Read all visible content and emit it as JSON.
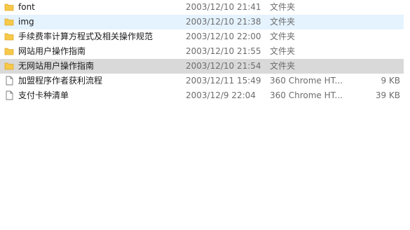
{
  "file_list": {
    "rows": [
      {
        "name": "font",
        "date": "2003/12/10 21:41",
        "type": "文件夹",
        "size": "",
        "icon": "folder-icon",
        "state": "normal"
      },
      {
        "name": "img",
        "date": "2003/12/10 21:38",
        "type": "文件夹",
        "size": "",
        "icon": "folder-icon",
        "state": "hover"
      },
      {
        "name": "手续费率计算方程式及相关操作规范",
        "date": "2003/12/10 22:00",
        "type": "文件夹",
        "size": "",
        "icon": "folder-icon",
        "state": "normal"
      },
      {
        "name": "网站用户操作指南",
        "date": "2003/12/10 21:55",
        "type": "文件夹",
        "size": "",
        "icon": "folder-icon",
        "state": "normal"
      },
      {
        "name": "无网站用户操作指南",
        "date": "2003/12/10 21:54",
        "type": "文件夹",
        "size": "",
        "icon": "folder-icon",
        "state": "selected"
      },
      {
        "name": "加盟程序作者获利流程",
        "date": "2003/12/11 15:49",
        "type": "360 Chrome HT...",
        "size": "9 KB",
        "icon": "file-icon",
        "state": "normal"
      },
      {
        "name": "支付卡种清单",
        "date": "2003/12/9 22:04",
        "type": "360 Chrome HT...",
        "size": "39 KB",
        "icon": "file-icon",
        "state": "normal"
      }
    ]
  },
  "colors": {
    "folder": "#f7c948",
    "folder_dark": "#e0a82e",
    "hover_bg": "#e5f3ff",
    "selected_bg": "#d9d9d9"
  }
}
